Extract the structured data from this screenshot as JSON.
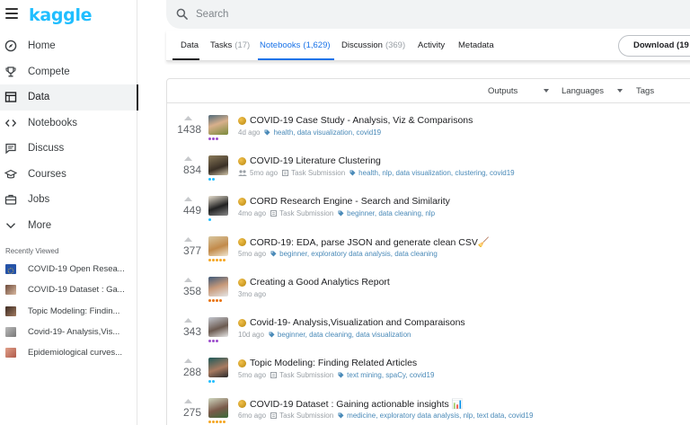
{
  "brand": {
    "logo": "kaggle",
    "color": "#20beff"
  },
  "nav": {
    "items": [
      {
        "label": "Home",
        "icon": "compass-icon"
      },
      {
        "label": "Compete",
        "icon": "trophy-icon"
      },
      {
        "label": "Data",
        "icon": "table-icon",
        "active": true
      },
      {
        "label": "Notebooks",
        "icon": "code-icon"
      },
      {
        "label": "Discuss",
        "icon": "comments-icon"
      },
      {
        "label": "Courses",
        "icon": "graduation-cap-icon"
      },
      {
        "label": "Jobs",
        "icon": "briefcase-icon"
      },
      {
        "label": "More",
        "icon": "chevron-down-icon"
      }
    ]
  },
  "recently_viewed": {
    "title": "Recently Viewed",
    "items": [
      {
        "label": "COVID-19 Open Resea..."
      },
      {
        "label": "COVID-19 Dataset : Ga..."
      },
      {
        "label": "Topic Modeling: Findin..."
      },
      {
        "label": "Covid-19- Analysis,Vis..."
      },
      {
        "label": "Epidemiological curves..."
      }
    ]
  },
  "search": {
    "placeholder": "Search"
  },
  "tabs": [
    {
      "label": "Data",
      "count": ""
    },
    {
      "label": "Tasks",
      "count": "(17)"
    },
    {
      "label": "Notebooks",
      "count": "(1,629)",
      "active": true
    },
    {
      "label": "Discussion",
      "count": "(369)"
    },
    {
      "label": "Activity",
      "count": ""
    },
    {
      "label": "Metadata",
      "count": ""
    }
  ],
  "download_label": "Download (19",
  "filters": {
    "outputs": "Outputs",
    "languages": "Languages",
    "tags": "Tags"
  },
  "task_submission_label": "Task Submission",
  "notebooks": [
    {
      "votes": "1438",
      "title": "COVID-19 Case Study - Analysis, Viz & Comparisons",
      "time": "4d ago",
      "task": false,
      "tags": "health, data visualization, covid19",
      "tier_color": "#9c4dcc",
      "tier_dots": 3
    },
    {
      "votes": "834",
      "title": "COVID-19 Literature Clustering",
      "time": "5mo ago",
      "task": true,
      "group_icon": true,
      "tags": "health, nlp, data visualization, clustering, covid19",
      "tier_color": "#20beff",
      "tier_dots": 2
    },
    {
      "votes": "449",
      "title": "CORD Research Engine - Search and Similarity",
      "time": "4mo ago",
      "task": true,
      "tags": "beginner, data cleaning, nlp",
      "tier_color": "#20beff",
      "tier_dots": 1
    },
    {
      "votes": "377",
      "title": "CORD-19: EDA, parse JSON and generate clean CSV🧹",
      "time": "5mo ago",
      "task": false,
      "tags": "beginner, exploratory data analysis, data cleaning",
      "tier_color": "#f5a623",
      "tier_dots": 5
    },
    {
      "votes": "358",
      "title": "Creating a Good Analytics Report",
      "time": "3mo ago",
      "task": false,
      "tags": "",
      "tier_color": "#e8710a",
      "tier_dots": 4
    },
    {
      "votes": "343",
      "title": "Covid-19- Analysis,Visualization and Comparaisons",
      "time": "10d ago",
      "task": false,
      "tags": "beginner, data cleaning, data visualization",
      "tier_color": "#9c4dcc",
      "tier_dots": 3
    },
    {
      "votes": "288",
      "title": "Topic Modeling: Finding Related Articles",
      "time": "5mo ago",
      "task": true,
      "tags": "text mining, spaCy, covid19",
      "tier_color": "#20beff",
      "tier_dots": 2
    },
    {
      "votes": "275",
      "title": "COVID-19 Dataset : Gaining actionable insights 📊",
      "time": "6mo ago",
      "task": true,
      "tags": "medicine, exploratory data analysis, nlp, text data, covid19",
      "tier_color": "#f5a623",
      "tier_dots": 5
    }
  ],
  "colors": {
    "accent": "#1a73e8",
    "tag": "#4a8ab8",
    "muted": "#9aa0a6"
  }
}
